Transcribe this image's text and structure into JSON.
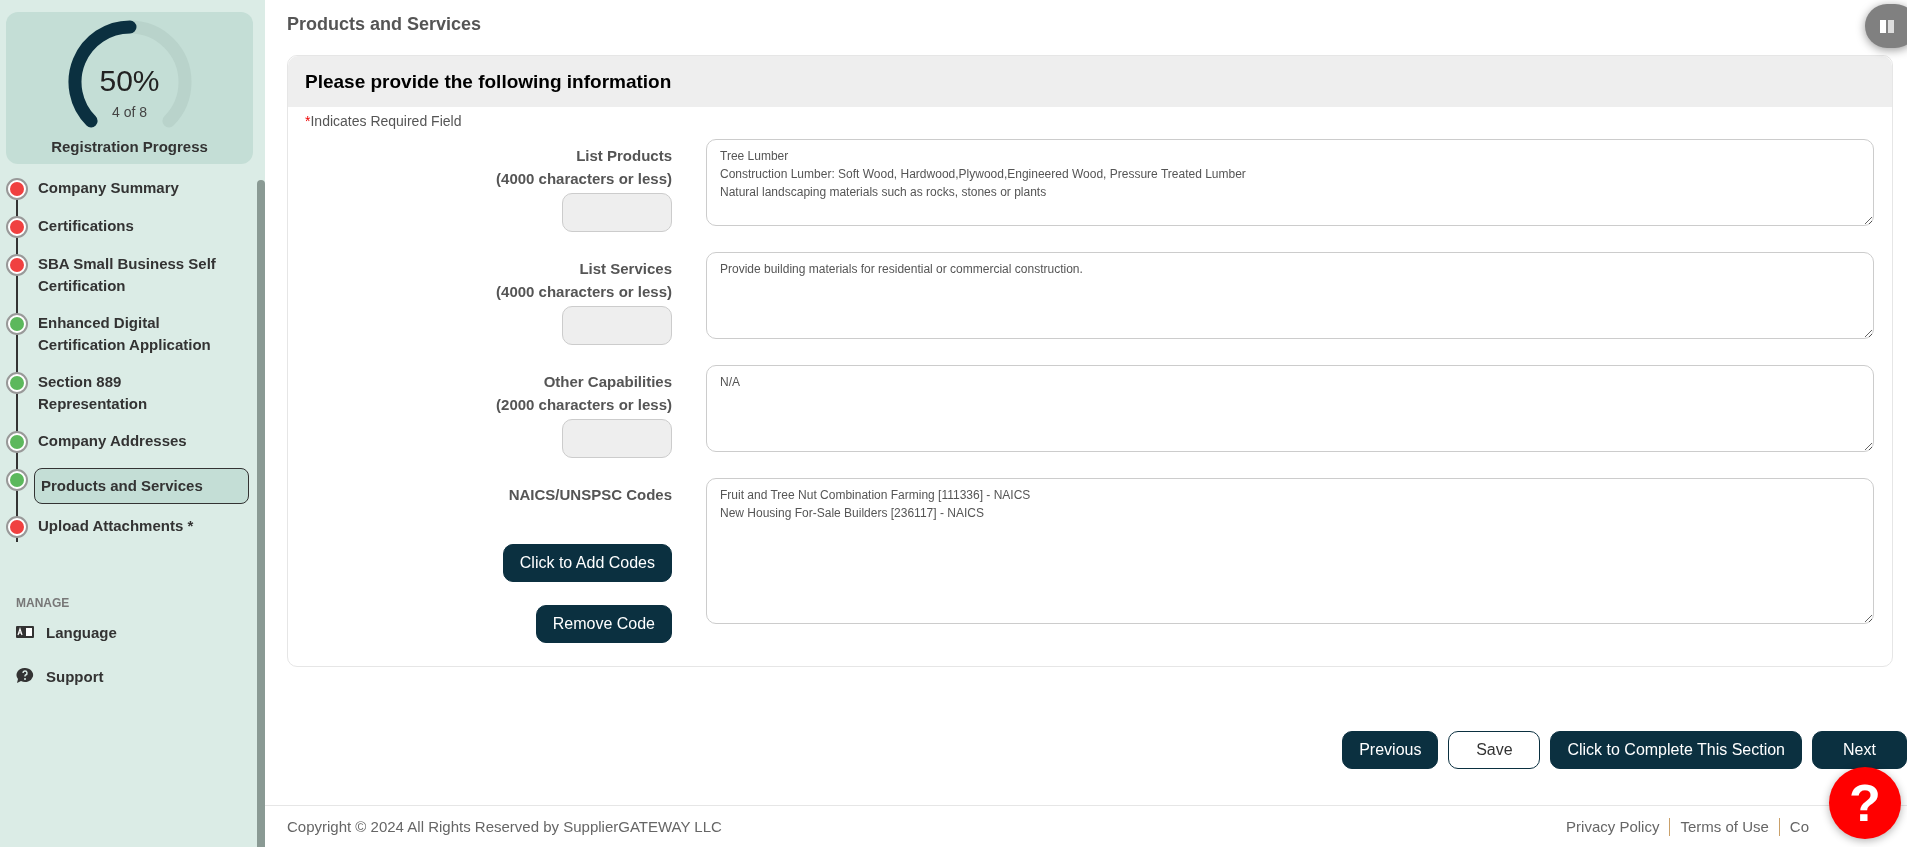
{
  "progress": {
    "percent": "50%",
    "count": "4 of 8",
    "label": "Registration Progress",
    "level": 0.5
  },
  "steps": [
    {
      "label": "Company Summary",
      "color": "#f04040",
      "selected": false
    },
    {
      "label": "Certifications",
      "color": "#f04040",
      "selected": false
    },
    {
      "label": "SBA Small Business Self Certification",
      "color": "#f04040",
      "selected": false
    },
    {
      "label": "Enhanced Digital Certification Application",
      "color": "#5cb85c",
      "selected": false
    },
    {
      "label": "Section 889 Representation",
      "color": "#5cb85c",
      "selected": false
    },
    {
      "label": "Company Addresses",
      "color": "#5cb85c",
      "selected": false
    },
    {
      "label": "Products and Services",
      "color": "#5cb85c",
      "selected": true
    },
    {
      "label": "Upload Attachments *",
      "color": "#f04040",
      "selected": false
    }
  ],
  "manage": {
    "heading": "MANAGE",
    "items": [
      {
        "kind": "language",
        "label": "Language"
      },
      {
        "kind": "support",
        "label": "Support"
      }
    ]
  },
  "page_title": "Products and Services",
  "form": {
    "heading": "Please provide the following information",
    "required_mark": "*",
    "required_note": "Indicates Required Field",
    "fields": [
      {
        "label": "List Products",
        "limit": "(4000 characters or less)",
        "lines": [
          "Tree Lumber",
          "Construction Lumber: Soft Wood, Hardwood,Plywood,Engineered Wood, Pressure Treated Lumber",
          "Natural landscaping materials such as rocks, stones or plants"
        ]
      },
      {
        "label": "List Services",
        "limit": "(4000 characters or less)",
        "lines": [
          "Provide building materials for residential or commercial construction."
        ]
      },
      {
        "label": "Other Capabilities",
        "limit": "(2000 characters or less)",
        "lines": [
          "N/A"
        ]
      }
    ],
    "codes": {
      "label": "NAICS/UNSPSC Codes",
      "lines": [
        "Fruit and Tree Nut Combination Farming [111336] - NAICS",
        "New Housing For-Sale Builders [236117] - NAICS"
      ],
      "buttons": [
        "Click to Add Codes",
        "Remove Code"
      ]
    }
  },
  "actions": [
    {
      "kind": "filled",
      "label": "Previous"
    },
    {
      "kind": "outline",
      "label": "Save"
    },
    {
      "kind": "filled",
      "label": "Click to Complete This Section"
    },
    {
      "kind": "filled",
      "label": "Next"
    }
  ],
  "footer": {
    "copyright": "Copyright © 2024 All Rights Reserved by SupplierGATEWAY LLC",
    "links": [
      "Privacy Policy",
      "Terms of Use",
      "Co"
    ]
  },
  "help_button": "?"
}
